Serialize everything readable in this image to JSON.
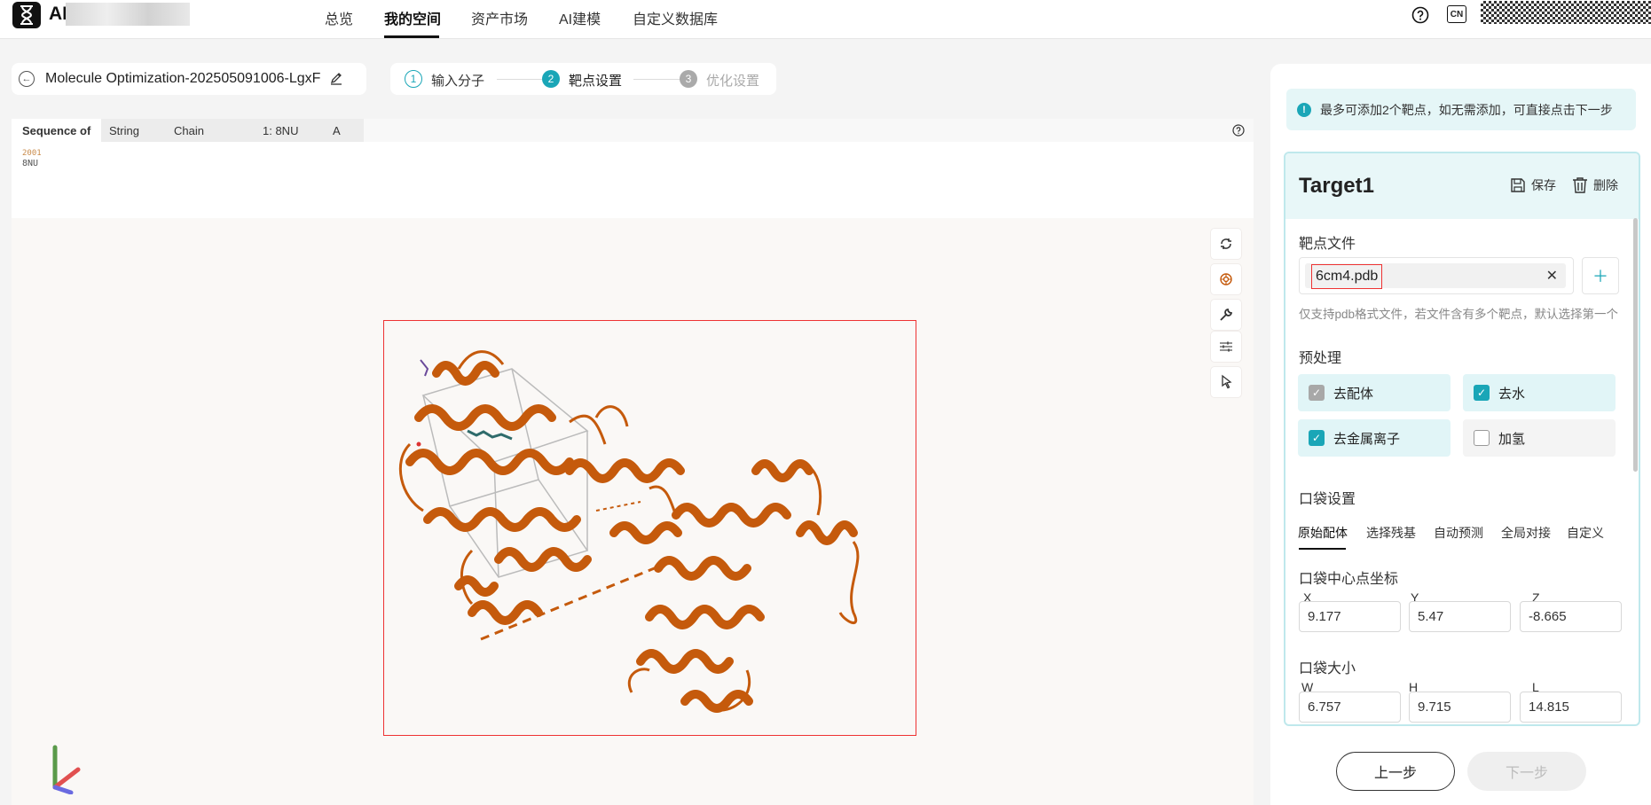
{
  "nav": {
    "logo_text": "AI",
    "items": [
      "总览",
      "我的空间",
      "资产市场",
      "AI建模",
      "自定义数据库"
    ],
    "lang": "CN"
  },
  "project": {
    "title": "Molecule Optimization-202505091006-LgxF"
  },
  "steps": [
    {
      "num": "1",
      "label": "输入分子",
      "state": "done"
    },
    {
      "num": "2",
      "label": "靶点设置",
      "state": "active"
    },
    {
      "num": "3",
      "label": "优化设置",
      "state": "pending"
    }
  ],
  "sequence": {
    "headers": [
      "Sequence of",
      "String",
      "Chain",
      "1: 8NU",
      "A"
    ],
    "residue_number": "2001",
    "residue_name": "8NU"
  },
  "viewer_tools": [
    "reset-icon",
    "focus-icon",
    "wrench-icon",
    "settings-sliders-icon",
    "pointer-icon"
  ],
  "panel": {
    "alert": "最多可添加2个靶点，如无需添加，可直接点击下一步",
    "target_title": "Target1",
    "save_label": "保存",
    "delete_label": "删除",
    "file_label": "靶点文件",
    "file_name": "6cm4.pdb",
    "file_hint": "仅支持pdb格式文件，若文件含有多个靶点，默认选择第一个",
    "preprocess_label": "预处理",
    "options": [
      {
        "label": "去配体",
        "checked": true,
        "disabled": true
      },
      {
        "label": "去水",
        "checked": true,
        "disabled": false
      },
      {
        "label": "去金属离子",
        "checked": true,
        "disabled": false
      },
      {
        "label": "加氢",
        "checked": false,
        "disabled": false
      }
    ],
    "pocket_label": "口袋设置",
    "pocket_tabs": [
      "原始配体",
      "选择残基",
      "自动预测",
      "全局对接",
      "自定义"
    ],
    "center_label": "口袋中心点坐标",
    "center": {
      "x_label": "X",
      "x": "9.177",
      "y_label": "Y",
      "y": "5.47",
      "z_label": "Z",
      "z": "-8.665"
    },
    "size_label": "口袋大小",
    "size": {
      "w_label": "W",
      "w": "6.757",
      "h_label": "H",
      "h": "9.715",
      "l_label": "L",
      "l": "14.815"
    }
  },
  "footer": {
    "prev": "上一步",
    "next": "下一步"
  },
  "colors": {
    "accent": "#1aa6b7",
    "protein": "#c55a0c",
    "highlight": "#e33333"
  }
}
